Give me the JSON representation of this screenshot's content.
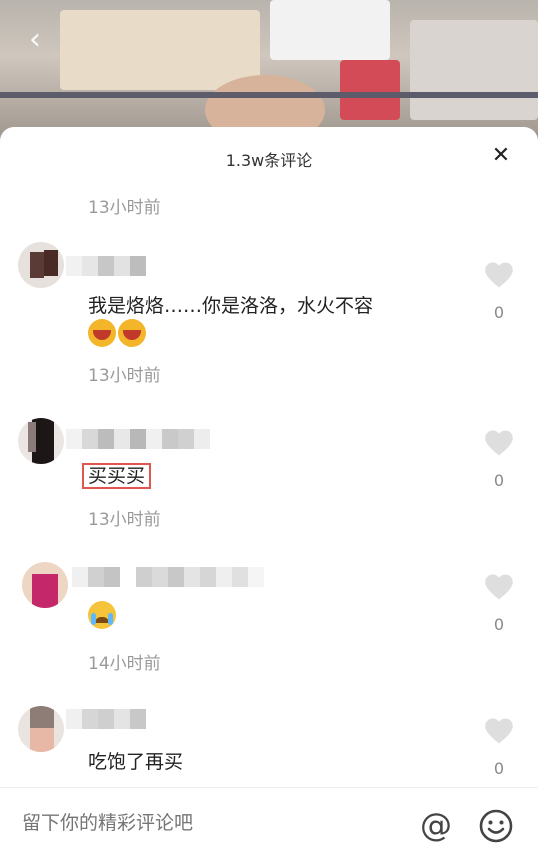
{
  "sheet": {
    "title": "1.3w条评论"
  },
  "top_time": "13小时前",
  "comments": [
    {
      "text": "我是烙烙……你是洛洛，水火不容",
      "time": "13小时前",
      "likes": "0"
    },
    {
      "text": "买买买",
      "time": "13小时前",
      "likes": "0"
    },
    {
      "text": "",
      "time": "14小时前",
      "likes": "0"
    },
    {
      "text": "吃饱了再买",
      "likes": "0"
    }
  ],
  "input": {
    "placeholder": "留下你的精彩评论吧"
  },
  "colors": {
    "highlight_box": "#e0574f",
    "muted": "#9a9a9a"
  }
}
